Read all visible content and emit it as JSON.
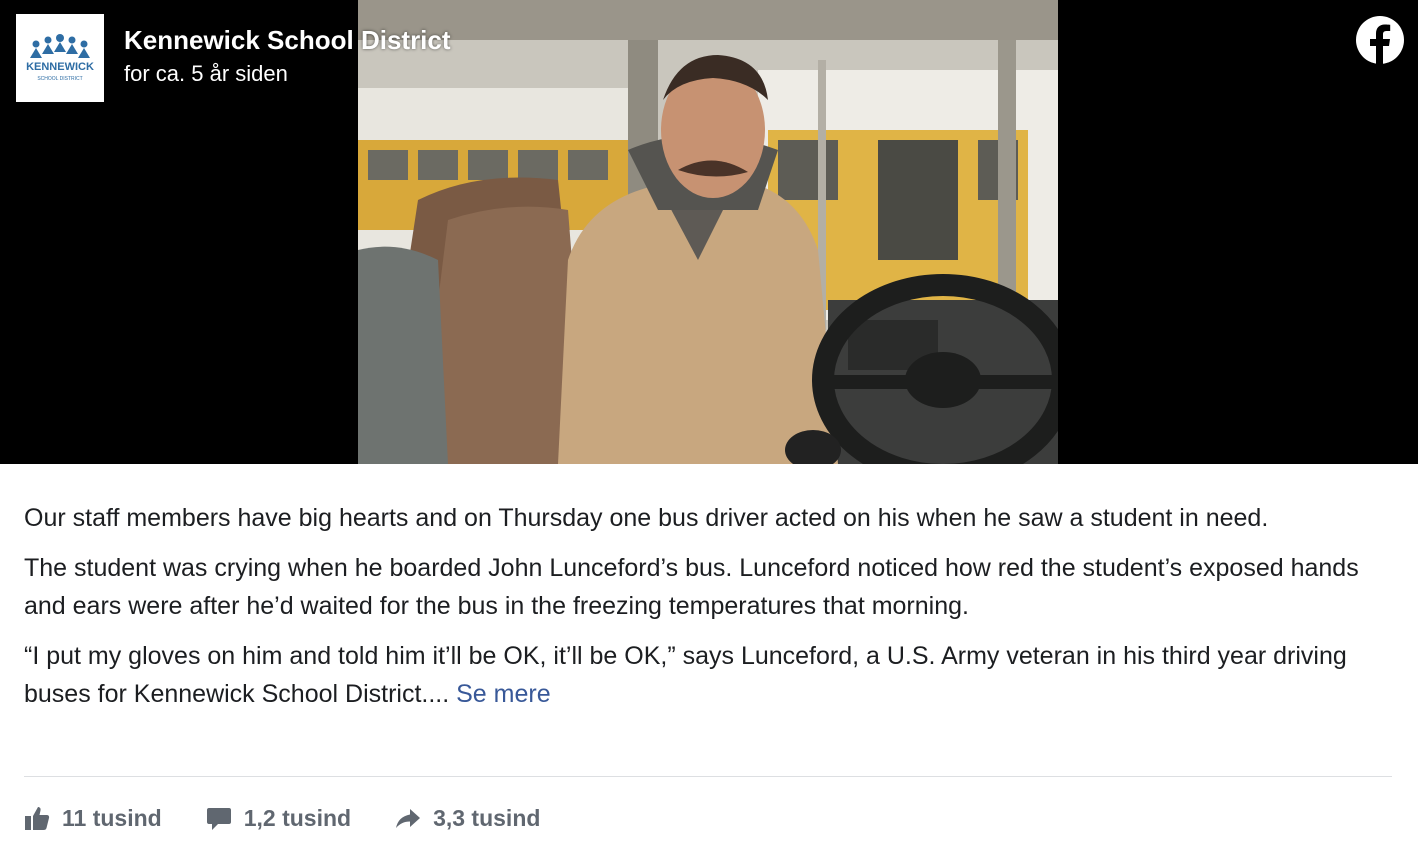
{
  "header": {
    "page_name": "Kennewick School District",
    "timestamp": "for ca. 5 år siden",
    "avatar_logo_text": "KENNEWICK",
    "avatar_logo_subtext": "SCHOOL DISTRICT",
    "social_icon": "facebook-icon"
  },
  "post": {
    "paragraphs": [
      "Our staff members have big hearts and on Thursday one bus driver acted on his when he saw a student in need.",
      "The student was crying when he boarded John Lunceford’s bus. Lunceford noticed how red the student’s exposed hands and ears were after he’d waited for the bus in the freezing temperatures that morning.",
      "“I put my gloves on him and told him it’ll be OK, it’ll be OK,” says Lunceford, a U.S. Army veteran in his third year driving buses for Kennewick School District...."
    ],
    "see_more": "Se mere"
  },
  "stats": {
    "likes": "11 tusind",
    "comments": "1,2 tusind",
    "shares": "3,3 tusind"
  },
  "colors": {
    "link": "#385898",
    "text": "#1c1e21",
    "muted": "#606770",
    "media_background": "#000000"
  }
}
